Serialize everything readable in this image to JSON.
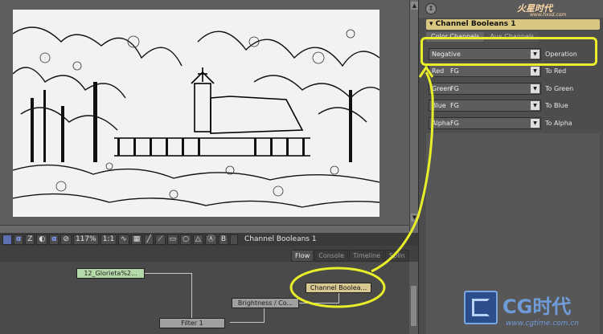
{
  "viewer": {
    "toolbar": {
      "channel_alpha_glyph": "α",
      "z_label": "Z",
      "alpha_btn": "α",
      "zoom": "117%",
      "ratio": "1:1",
      "b_label": "B"
    },
    "name": "Channel Booleans 1"
  },
  "flow": {
    "tabs": [
      "Flow",
      "Console",
      "Timeline",
      "Splin"
    ],
    "nodes": {
      "loader": "12_Glorieta%2...",
      "brightness": "Brightness / Co...",
      "filter": "Filter 1",
      "channel_booleans": "Channel Boolea..."
    }
  },
  "control_panel": {
    "tool_title": "Channel Booleans 1",
    "tabs": [
      "Color Channels",
      "Aux Channels"
    ],
    "operation": {
      "value": "Negative",
      "label": "Operation"
    },
    "rows": [
      {
        "channel": "Red",
        "value": "FG",
        "label": "To Red"
      },
      {
        "channel": "Green",
        "value": "FG",
        "label": "To Green"
      },
      {
        "channel": "Blue",
        "value": "FG",
        "label": "To Blue"
      },
      {
        "channel": "Alpha",
        "value": "FG",
        "label": "To Alpha"
      }
    ]
  },
  "watermarks": {
    "top": "火星时代",
    "top_url": "www.hxsd.com",
    "logo_text": "CG时代",
    "logo_url": "www.cgtime.com.cn"
  },
  "colors": {
    "highlight": "#e8ee2a",
    "tool_header": "#d9c77f",
    "loader_node": "#b5d9a8"
  }
}
